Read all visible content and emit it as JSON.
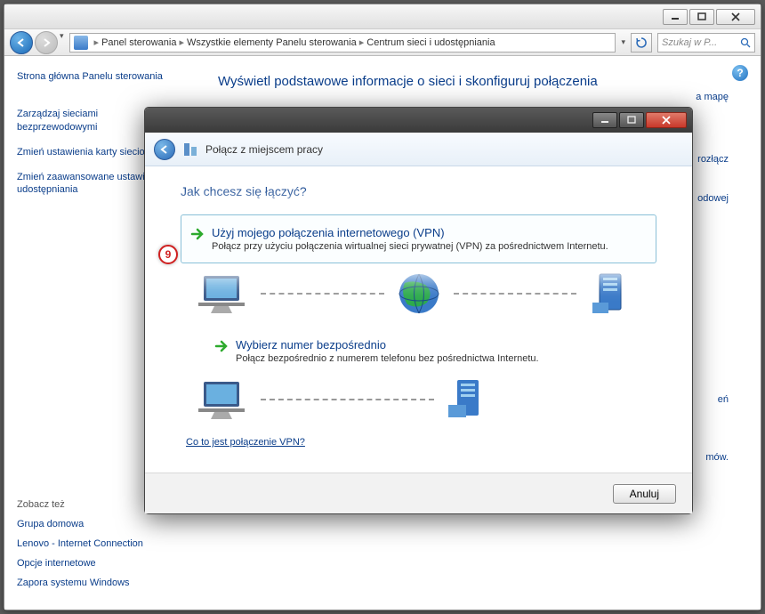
{
  "outer": {
    "breadcrumb": [
      "Panel sterowania",
      "Wszystkie elementy Panelu sterowania",
      "Centrum sieci i udostępniania"
    ],
    "search_placeholder": "Szukaj w P...",
    "heading": "Wyświetl podstawowe informacje o sieci i skonfiguruj połączenia",
    "bg_links": [
      "a mapę",
      "rozłącz",
      "odowej",
      "eń",
      "mów."
    ]
  },
  "sidebar": {
    "main": [
      "Strona główna Panelu sterowania",
      "Zarządzaj sieciami bezprzewodowymi",
      "Zmień ustawienia karty sieciowej",
      "Zmień zaawansowane ustawienia udostępniania"
    ],
    "see_label": "Zobacz też",
    "see": [
      "Grupa domowa",
      "Lenovo - Internet Connection",
      "Opcje internetowe",
      "Zapora systemu Windows"
    ]
  },
  "dialog": {
    "title": "Połącz z miejscem pracy",
    "heading": "Jak chcesz się łączyć?",
    "option1": {
      "title": "Użyj mojego połączenia internetowego (VPN)",
      "desc": "Połącz przy użyciu połączenia wirtualnej sieci prywatnej (VPN) za pośrednictwem Internetu."
    },
    "option2": {
      "title": "Wybierz numer bezpośrednio",
      "desc": "Połącz bezpośrednio z numerem telefonu bez pośrednictwa Internetu."
    },
    "vpn_link": "Co to jest połączenie VPN?",
    "cancel": "Anuluj"
  },
  "callout": "9"
}
